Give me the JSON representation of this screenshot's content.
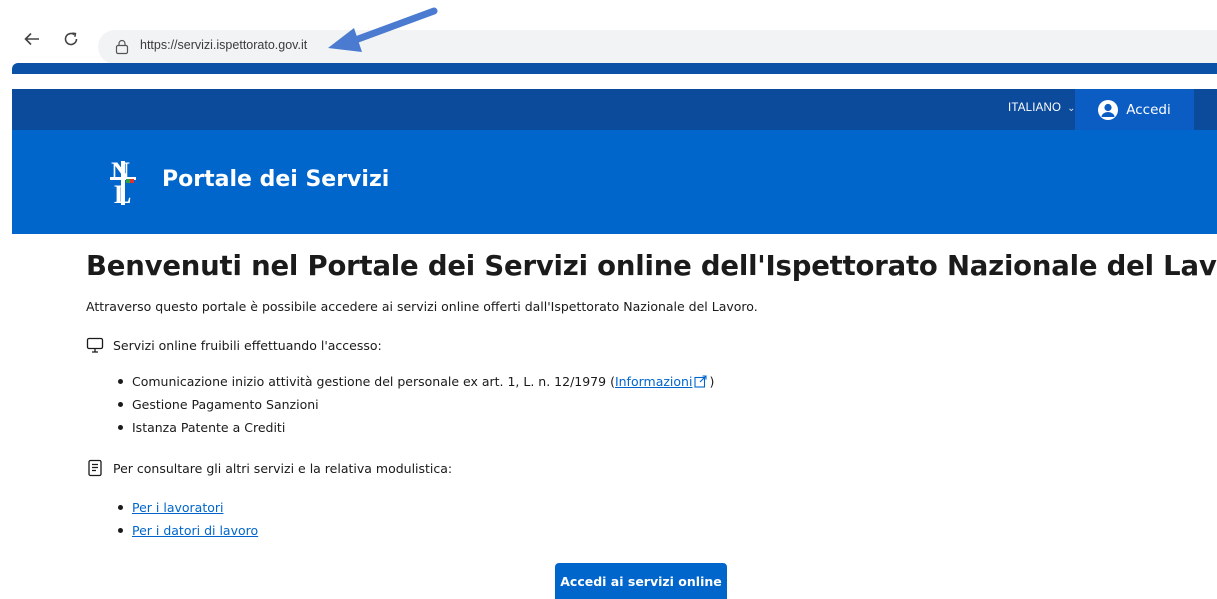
{
  "browser": {
    "url": "https://servizi.ispettorato.gov.it",
    "back_icon": "back-arrow-icon",
    "reload_icon": "reload-icon",
    "site_info_icon": "lock-icon"
  },
  "header": {
    "language": "ITALIANO",
    "login_label": "Accedi",
    "site_title": "Portale dei Servizi",
    "colors": {
      "slim": "#0c4a9b",
      "main": "#0066cc",
      "login": "#0b5cc3"
    }
  },
  "main": {
    "title": "Benvenuti nel Portale dei Servizi online dell'Ispettorato Nazionale del Lavoro",
    "intro": "Attraverso questo portale è possibile accedere ai servizi online offerti dall'Ispettorato Nazionale del Lavoro.",
    "online_section": {
      "label": "Servizi online fruibili effettuando l'accesso:",
      "items": [
        {
          "text": "Comunicazione inizio attività gestione del personale ex art. 1, L. n. 12/1979 (",
          "link": "Informazioni",
          "suffix": ")"
        },
        {
          "text": "Gestione Pagamento Sanzioni"
        },
        {
          "text": "Istanza Patente a Crediti"
        }
      ]
    },
    "other_section": {
      "label": "Per consultare gli altri servizi e la relativa modulistica:",
      "links": [
        "Per i lavoratori",
        "Per i datori di lavoro"
      ]
    },
    "cta_label": "Accedi ai servizi online"
  }
}
